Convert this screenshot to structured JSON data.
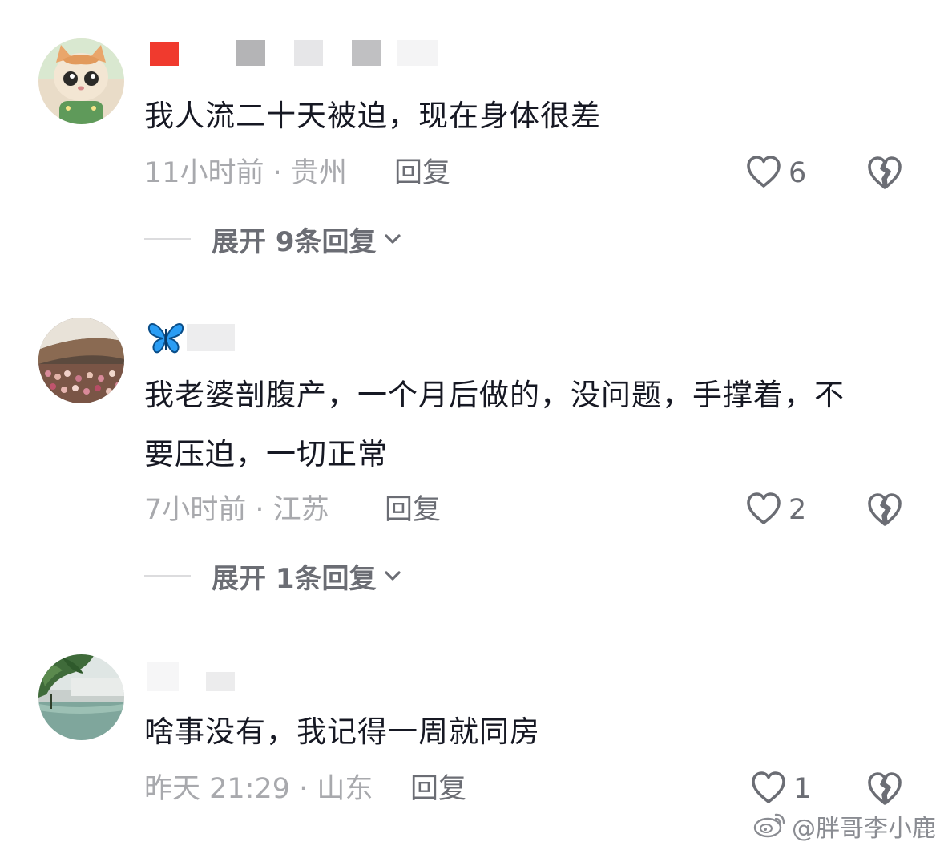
{
  "comments": [
    {
      "text": "我人流二十天被迫，现在身体很差",
      "time_location": "11小时前 · 贵州",
      "reply_label": "回复",
      "like_count": "6",
      "expand_label": "展开 9条回复"
    },
    {
      "text": "我老婆剖腹产，一个月后做的，没问题，手撑着，不要压迫，一切正常",
      "time_location": "7小时前 · 江苏",
      "reply_label": "回复",
      "like_count": "2",
      "expand_label": "展开 1条回复"
    },
    {
      "text": "啥事没有，我记得一周就同房",
      "time_location": "昨天 21:29 · 山东",
      "reply_label": "回复",
      "like_count": "1"
    }
  ],
  "watermark": {
    "text": "@胖哥李小鹿",
    "icon": "weibo-icon"
  },
  "colors": {
    "text_primary": "#161823",
    "meta_gray": "#a8a9ad",
    "action_gray": "#6b6d74",
    "butterfly_blue": "#2a9df4"
  },
  "icons": {
    "like": "heart-outline-icon",
    "dislike": "broken-heart-icon",
    "expand": "chevron-down-icon"
  }
}
